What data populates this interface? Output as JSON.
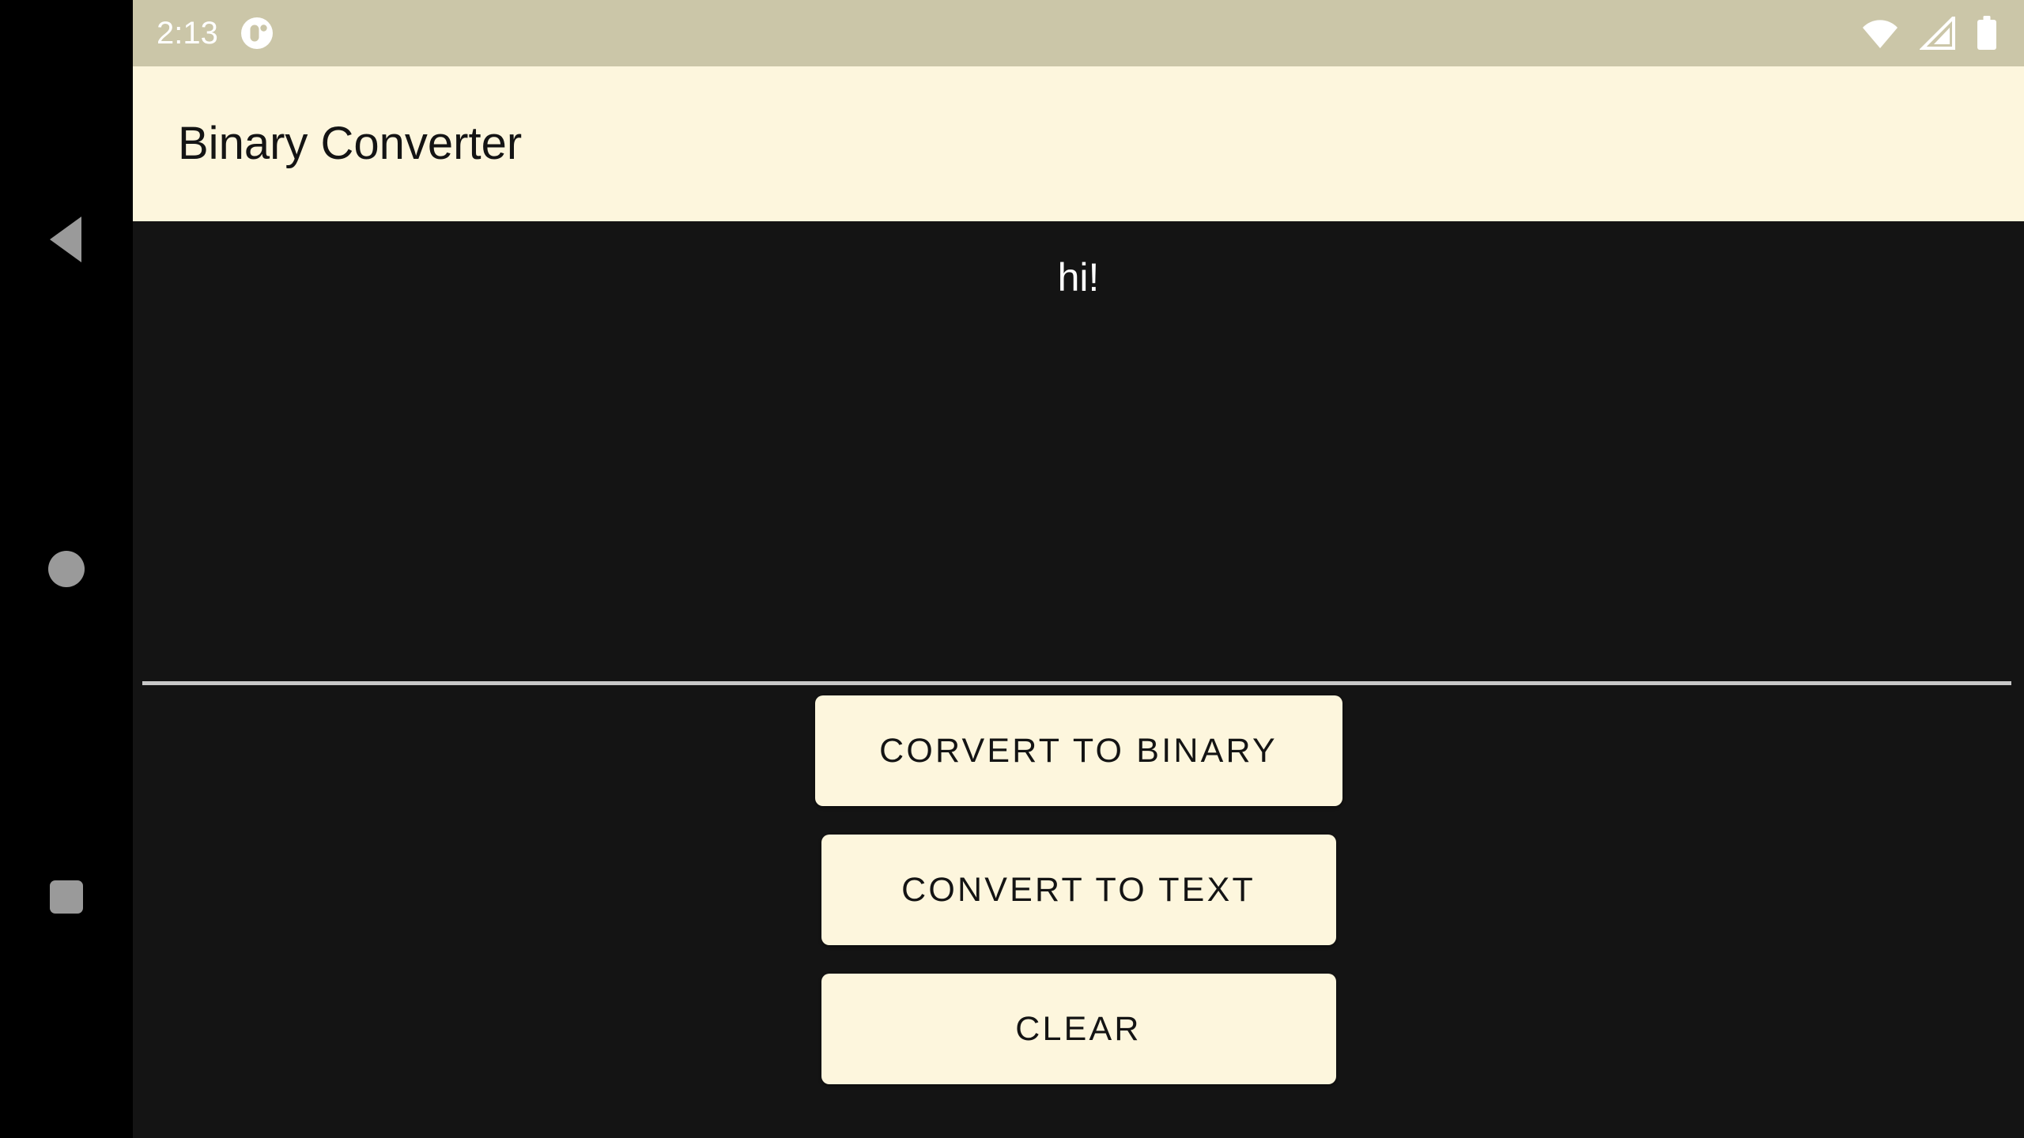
{
  "status_bar": {
    "time": "2:13",
    "notification_icon": "app-notification-icon",
    "wifi_icon": "wifi-icon",
    "cellular_icon": "cellular-signal-icon",
    "battery_icon": "battery-full-icon",
    "background_color": "#cbc6a8",
    "foreground_color": "#ffffff"
  },
  "app_bar": {
    "title": "Binary Converter",
    "background_color": "#fdf6dd",
    "text_color": "#141414"
  },
  "main": {
    "background_color": "#141414",
    "text_field": {
      "value": "hi!",
      "placeholder": "",
      "text_color": "#ffffff",
      "underline_color": "#c8c8c8"
    },
    "buttons": [
      {
        "id": "convert-to-binary",
        "label": "CORVERT TO BINARY",
        "background_color": "#fdf6dd",
        "text_color": "#141414"
      },
      {
        "id": "convert-to-text",
        "label": "CONVERT TO TEXT",
        "background_color": "#fdf6dd",
        "text_color": "#141414"
      },
      {
        "id": "clear",
        "label": "CLEAR",
        "background_color": "#fdf6dd",
        "text_color": "#141414"
      }
    ]
  },
  "navigation_bar": {
    "background_color": "#000000",
    "icon_color": "#9a9a9a",
    "items": [
      {
        "id": "back",
        "icon": "back-triangle-icon"
      },
      {
        "id": "home",
        "icon": "home-circle-icon"
      },
      {
        "id": "recents",
        "icon": "recents-square-icon"
      }
    ]
  }
}
